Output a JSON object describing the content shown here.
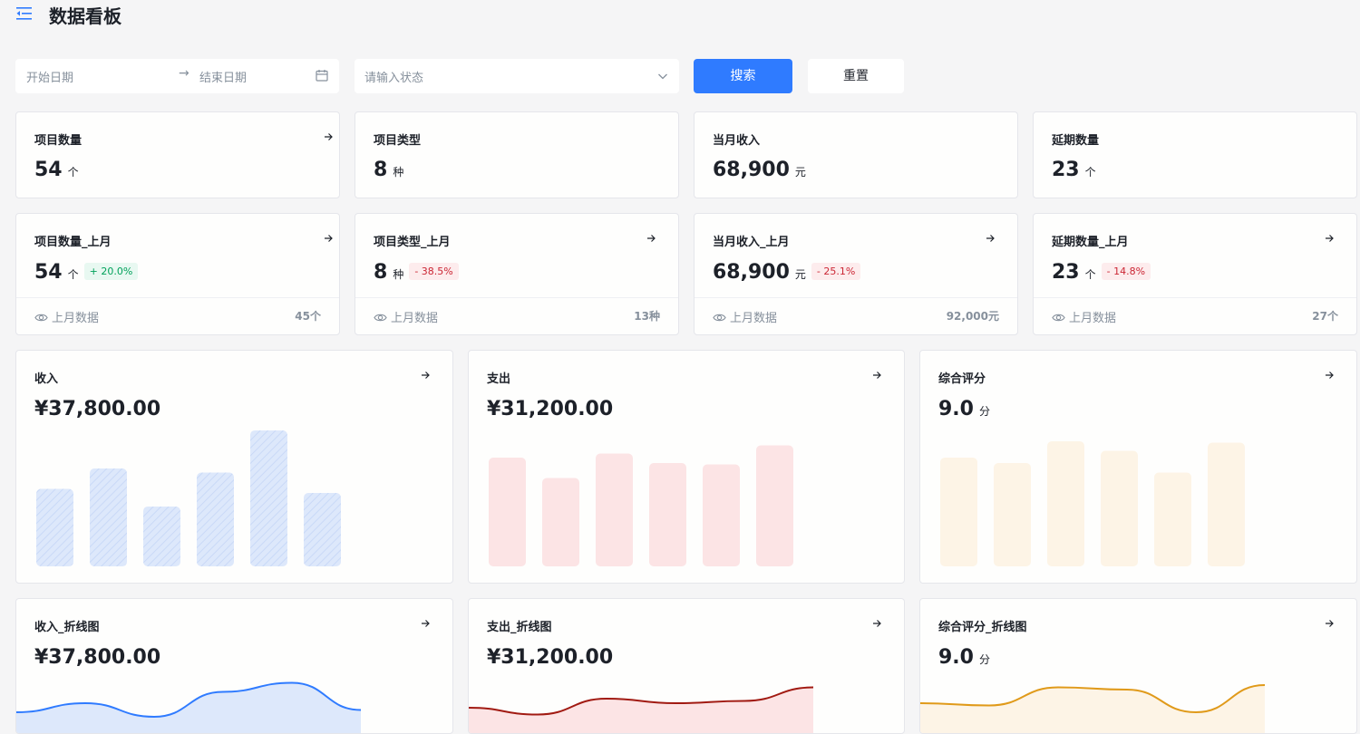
{
  "header": {
    "title": "数据看板",
    "menu_icon": "menu-fold-icon"
  },
  "filters": {
    "start_date_placeholder": "开始日期",
    "end_date_placeholder": "结束日期",
    "range_separator": "→",
    "status_placeholder": "请输入状态",
    "search_label": "搜索",
    "reset_label": "重置"
  },
  "stats": [
    {
      "title": "项目数量",
      "value": "54",
      "unit": "个"
    },
    {
      "title": "项目类型",
      "value": "8",
      "unit": "种"
    },
    {
      "title": "当月收入",
      "value": "68,900",
      "unit": "元"
    },
    {
      "title": "延期数量",
      "value": "23",
      "unit": "个"
    }
  ],
  "stats_compare": [
    {
      "title": "项目数量_上月",
      "value": "54",
      "unit": "个",
      "change": "+ 20.0%",
      "trend": "up",
      "footer_label": "上月数据",
      "footer_value": "45个"
    },
    {
      "title": "项目类型_上月",
      "value": "8",
      "unit": "种",
      "change": "- 38.5%",
      "trend": "down",
      "footer_label": "上月数据",
      "footer_value": "13种"
    },
    {
      "title": "当月收入_上月",
      "value": "68,900",
      "unit": "元",
      "change": "- 25.1%",
      "trend": "down",
      "footer_label": "上月数据",
      "footer_value": "92,000元"
    },
    {
      "title": "延期数量_上月",
      "value": "23",
      "unit": "个",
      "change": "- 14.8%",
      "trend": "down",
      "footer_label": "上月数据",
      "footer_value": "27个"
    }
  ],
  "bar_cards": [
    {
      "title": "收入",
      "value": "¥37,800.00",
      "unit": "",
      "color": "#dde8fb",
      "hatch": true
    },
    {
      "title": "支出",
      "value": "¥31,200.00",
      "unit": "",
      "color": "#fce4e5",
      "hatch": false
    },
    {
      "title": "综合评分",
      "value": "9.0",
      "unit": "分",
      "color": "#fdf4e6",
      "hatch": false
    }
  ],
  "line_cards": [
    {
      "title": "收入_折线图",
      "value": "¥37,800.00",
      "unit": "",
      "stroke": "#2f7bff",
      "fill": "#dde8fb"
    },
    {
      "title": "支出_折线图",
      "value": "¥31,200.00",
      "unit": "",
      "stroke": "#a11a12",
      "fill": "#fce4e5"
    },
    {
      "title": "综合评分_折线图",
      "value": "9.0",
      "unit": "分",
      "stroke": "#e09a1a",
      "fill": "#fdf4e6"
    }
  ],
  "chart_data": [
    {
      "type": "bar",
      "series": [
        {
          "values": [
            57,
            72,
            44,
            69,
            100,
            54
          ]
        }
      ],
      "ylim": [
        0,
        100
      ],
      "grid": false
    },
    {
      "type": "bar",
      "series": [
        {
          "values": [
            80,
            65,
            83,
            76,
            75,
            89
          ]
        }
      ],
      "ylim": [
        0,
        100
      ],
      "grid": false
    },
    {
      "type": "bar",
      "series": [
        {
          "values": [
            80,
            76,
            92,
            85,
            69,
            91
          ]
        }
      ],
      "ylim": [
        0,
        100
      ],
      "grid": false
    },
    {
      "type": "area",
      "series": [
        {
          "values": [
            30,
            50,
            20,
            75,
            95,
            35
          ]
        }
      ],
      "ylim": [
        0,
        100
      ],
      "grid": false
    },
    {
      "type": "area",
      "series": [
        {
          "values": [
            40,
            25,
            60,
            50,
            55,
            85
          ]
        }
      ],
      "ylim": [
        0,
        100
      ],
      "grid": false
    },
    {
      "type": "area",
      "series": [
        {
          "values": [
            50,
            45,
            85,
            80,
            30,
            90
          ]
        }
      ],
      "ylim": [
        0,
        100
      ],
      "grid": false
    }
  ]
}
